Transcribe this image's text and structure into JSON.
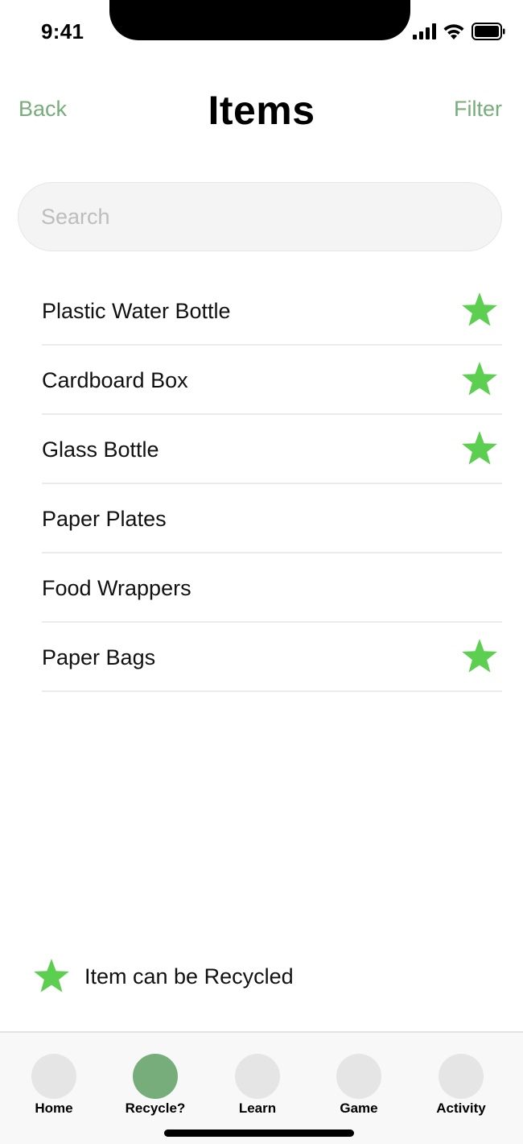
{
  "status_bar": {
    "time": "9:41"
  },
  "nav": {
    "back_label": "Back",
    "title": "Items",
    "filter_label": "Filter"
  },
  "search": {
    "placeholder": "Search",
    "value": ""
  },
  "items": [
    {
      "label": "Plastic Water Bottle",
      "recyclable": true
    },
    {
      "label": "Cardboard Box",
      "recyclable": true
    },
    {
      "label": "Glass Bottle",
      "recyclable": true
    },
    {
      "label": "Paper Plates",
      "recyclable": false
    },
    {
      "label": "Food Wrappers",
      "recyclable": false
    },
    {
      "label": "Paper Bags",
      "recyclable": true
    }
  ],
  "legend": {
    "icon": "star-icon",
    "text": "Item can be Recycled"
  },
  "tabs": [
    {
      "label": "Home",
      "active": false
    },
    {
      "label": "Recycle?",
      "active": true
    },
    {
      "label": "Learn",
      "active": false
    },
    {
      "label": "Game",
      "active": false
    },
    {
      "label": "Activity",
      "active": false
    }
  ],
  "colors": {
    "accent": "#76ad7b",
    "star": "#5dcf50",
    "tab_inactive": "#e5e5e5"
  }
}
